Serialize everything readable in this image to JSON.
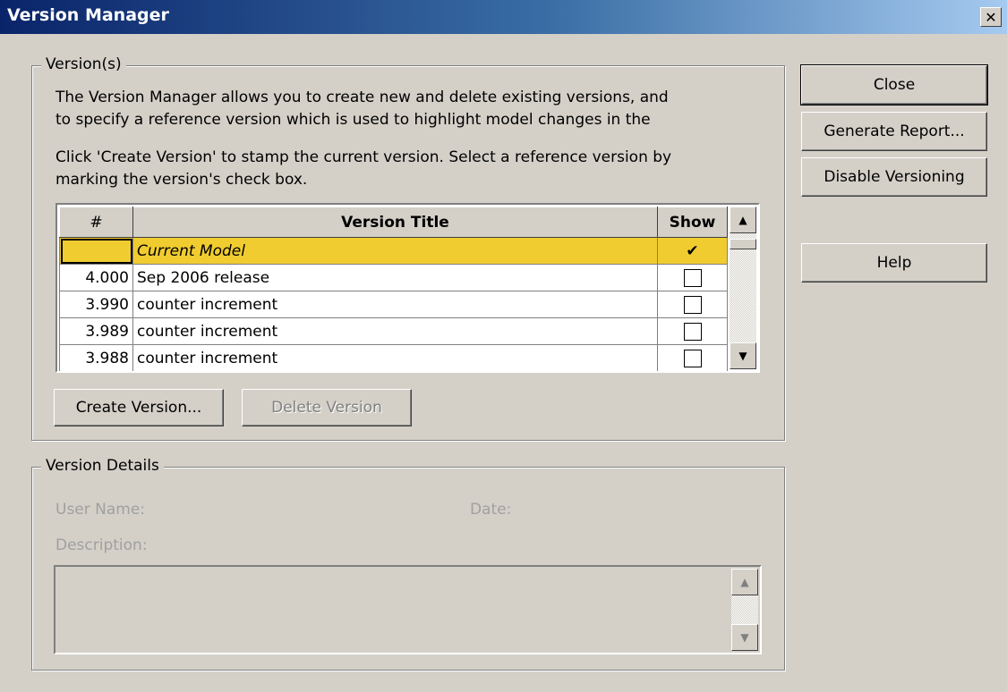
{
  "window": {
    "title": "Version Manager",
    "close_glyph": "✕"
  },
  "versions_group": {
    "legend": "Version(s)",
    "intro_line1": "The Version Manager allows you to create new and delete existing versions, and",
    "intro_line2": "to specify a reference version which is used to highlight model changes in the",
    "hint_line1": "Click 'Create Version' to stamp the current version. Select a reference version by",
    "hint_line2": "marking the version's check box.",
    "columns": {
      "num": "#",
      "title": "Version Title",
      "show": "Show"
    },
    "rows": [
      {
        "num": "",
        "title": "Current Model",
        "show": true
      },
      {
        "num": "4.000",
        "title": "Sep 2006 release",
        "show": false
      },
      {
        "num": "3.990",
        "title": "counter increment",
        "show": false
      },
      {
        "num": "3.989",
        "title": "counter increment",
        "show": false
      },
      {
        "num": "3.988",
        "title": "counter increment",
        "show": false
      }
    ],
    "create_button": "Create Version...",
    "delete_button": "Delete Version"
  },
  "details_group": {
    "legend": "Version Details",
    "user_name_label": "User Name:",
    "date_label": "Date:",
    "description_label": "Description:"
  },
  "side_buttons": {
    "close": "Close",
    "generate_report": "Generate Report...",
    "disable_versioning": "Disable Versioning",
    "help": "Help"
  },
  "glyphs": {
    "check": "✔",
    "up": "▲",
    "down": "▼"
  }
}
